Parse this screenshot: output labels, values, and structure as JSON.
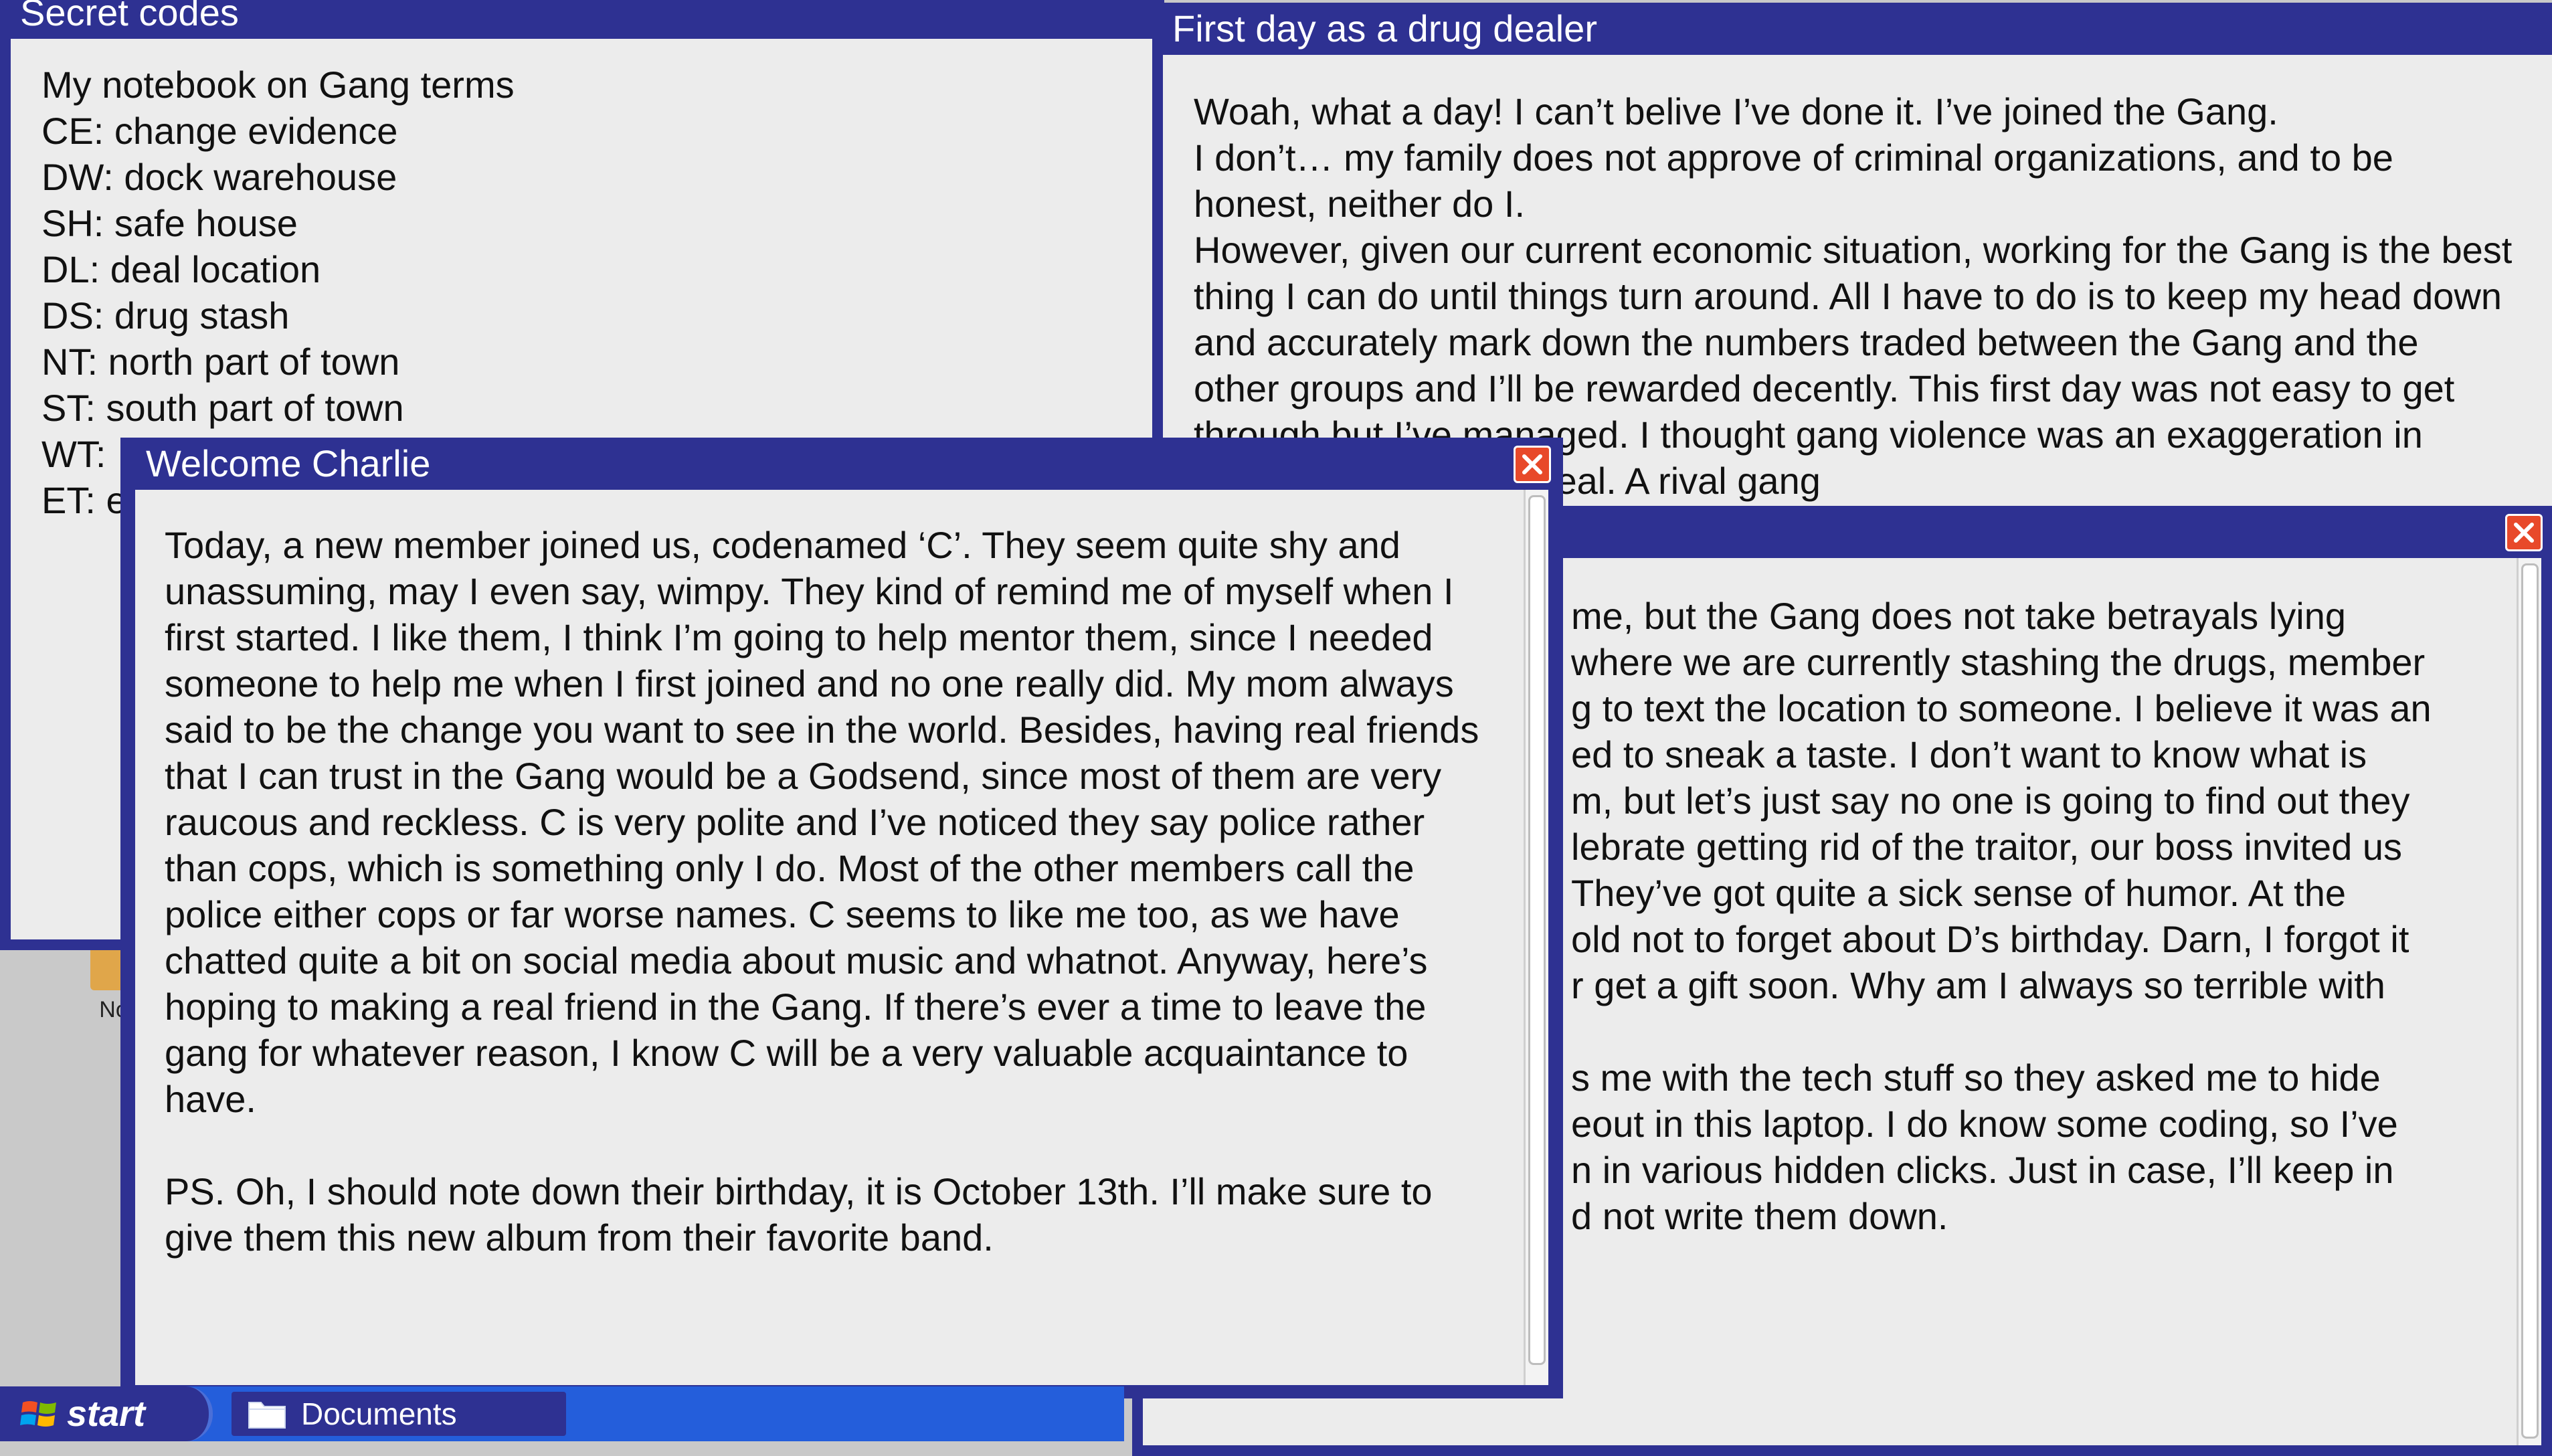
{
  "desktop": {
    "icon_label": "No"
  },
  "windows": {
    "secret_codes": {
      "title": "Secret codes",
      "body": "My notebook on Gang terms\nCE: change evidence\nDW: dock warehouse\nSH: safe house\nDL: deal location\nDS: drug stash\nNT: north part of town\nST: south part of town\nWT: \nET: e"
    },
    "first_day": {
      "title": "First day as a drug dealer",
      "body": "Woah, what a day! I can’t belive I’ve done it. I’ve joined the Gang.\nI don’t… my family does not approve of criminal organizations, and to be honest, neither do I.\nHowever, given our current economic situation, working for the Gang is the best thing I can do until things turn around. All I have to do is to keep my head down and accurately mark down the numbers traded between the Gang and the other groups and I’ll be rewarded decently. This first day was not easy to get through but I’ve managed. I thought gang violence was an exaggeration in movies, but it is very real. A rival gang"
    },
    "third_window": {
      "title": "",
      "body": "me, but the Gang does not take betrayals lying\nwhere we are currently stashing the drugs, member\ng to text the location to someone. I believe it was an\ned to sneak a taste. I don’t want to know what is\nm, but let’s just say no one is going to find out they\nlebrate getting rid of the traitor, our boss invited us\nThey’ve got quite a sick sense of humor. At the\nold not to forget about D’s birthday. Darn, I forgot it\nr get a gift soon. Why am I always so terrible with\n\ns me with the tech stuff so they asked me to hide\neout in this laptop. I do know some coding, so I’ve\nn in various hidden clicks. Just in case, I’ll keep in\nd not write them down."
    },
    "welcome_charlie": {
      "title": "Welcome Charlie",
      "body": "Today, a new member joined us, codenamed ‘C’. They seem quite shy and unassuming, may I even say, wimpy. They kind of remind me of myself when I first started. I like them, I think I’m going to help mentor them, since I needed someone to help me when I first joined and no one really did. My mom always said to be the change you want to see in the world. Besides, having real friends that I can trust in the Gang would be a Godsend, since most of them are very raucous and reckless. C is very polite and I’ve noticed they say police rather than cops, which is something only I do. Most of the other members call the police either cops or far worse names. C seems to like me too, as we have chatted quite a bit on social media about music and whatnot. Anyway, here’s hoping to making a real friend in the Gang. If there’s ever a time to leave the gang for whatever reason, I know C will be a very valuable acquaintance to have.\n\nPS. Oh, I should note down their birthday, it is October 13th. I’ll make sure to give them this new album from their favorite band."
    }
  },
  "taskbar": {
    "start_label": "start",
    "task_label": "Documents"
  },
  "colors": {
    "title_bar": "#2e3192",
    "taskbar": "#245edb",
    "close_button": "#e8492a",
    "content_bg": "#ececec"
  }
}
